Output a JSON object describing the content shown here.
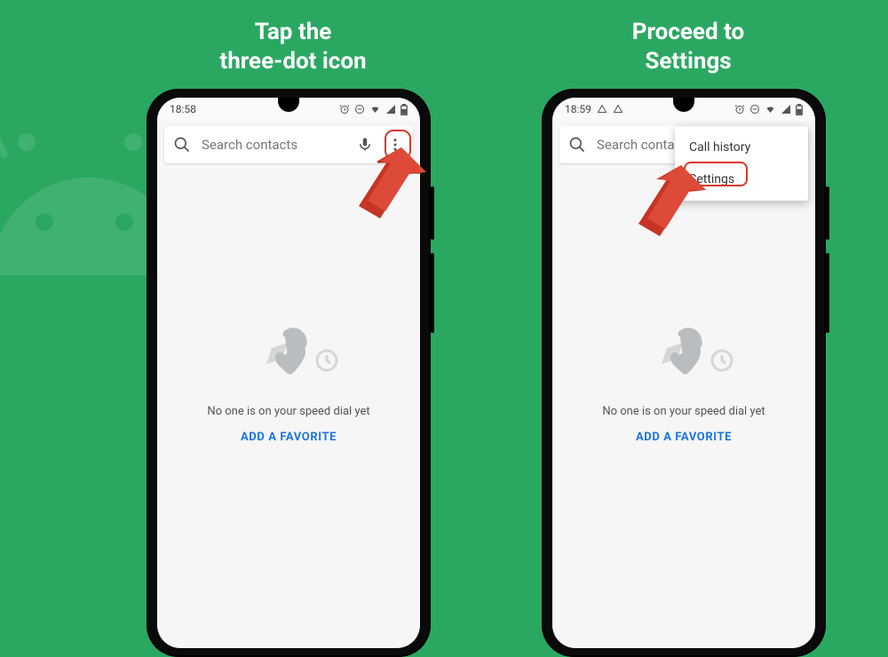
{
  "captions": {
    "left_line1": "Tap the",
    "left_line2": "three-dot icon",
    "right_line1": "Proceed to",
    "right_line2": "Settings"
  },
  "phone_left": {
    "status_time": "18:58",
    "search_placeholder": "Search contacts",
    "empty_message": "No one is on your speed dial yet",
    "add_favorite": "ADD A FAVORITE"
  },
  "phone_right": {
    "status_time": "18:59",
    "search_placeholder": "Search conta",
    "menu_item_1": "Call history",
    "menu_item_2": "Settings",
    "empty_message": "No one is on your speed dial yet",
    "add_favorite": "ADD A FAVORITE"
  }
}
